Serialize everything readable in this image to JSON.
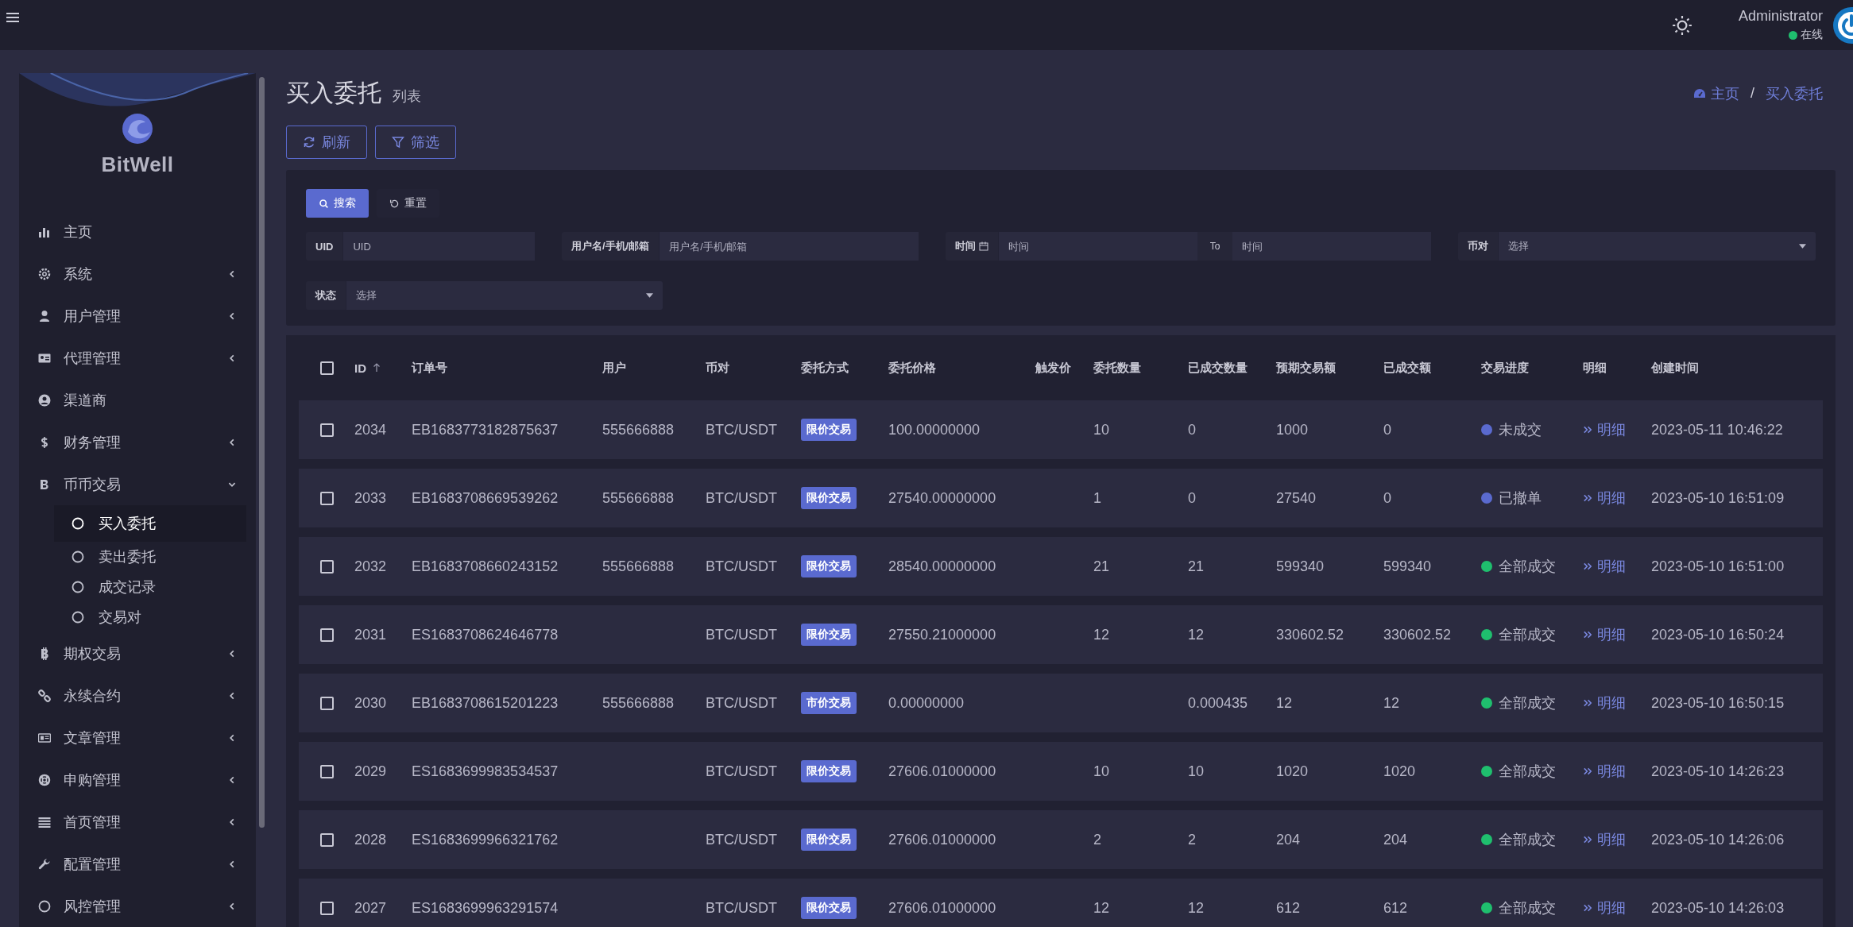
{
  "header": {
    "user_name": "Administrator",
    "status": "在线"
  },
  "sidebar": {
    "brand": "BitWell",
    "items": [
      {
        "label": "主页"
      },
      {
        "label": "系统",
        "expanded": false
      },
      {
        "label": "用户管理",
        "expanded": false
      },
      {
        "label": "代理管理",
        "expanded": false
      },
      {
        "label": "渠道商"
      },
      {
        "label": "财务管理",
        "expanded": false
      },
      {
        "label": "币币交易",
        "expanded": true,
        "children": [
          {
            "label": "买入委托",
            "selected": true
          },
          {
            "label": "卖出委托",
            "selected": false
          },
          {
            "label": "成交记录",
            "selected": false
          },
          {
            "label": "交易对",
            "selected": false
          }
        ]
      },
      {
        "label": "期权交易",
        "expanded": false
      },
      {
        "label": "永续合约",
        "expanded": false
      },
      {
        "label": "文章管理",
        "expanded": false
      },
      {
        "label": "申购管理",
        "expanded": false
      },
      {
        "label": "首页管理",
        "expanded": false
      },
      {
        "label": "配置管理",
        "expanded": false
      },
      {
        "label": "风控管理",
        "expanded": false
      }
    ]
  },
  "page": {
    "title": "买入委托",
    "subtitle": "列表",
    "breadcrumb": [
      "主页",
      "买入委托"
    ],
    "breadcrumb_separator": "/",
    "buttons": [
      "刷新",
      "筛选"
    ]
  },
  "filter": {
    "search_button": "搜索",
    "reset_button": "重置",
    "fields": [
      {
        "kind": "text",
        "label": "UID",
        "placeholder": "UID"
      },
      {
        "kind": "text",
        "label": "用户名/手机/邮箱",
        "placeholder": "用户名/手机/邮箱"
      },
      {
        "kind": "range",
        "label": "时间",
        "placeholder": "时间",
        "separator": "To",
        "placeholder_end": "时间"
      },
      {
        "kind": "select",
        "label": "币对",
        "placeholder": "选择"
      },
      {
        "kind": "select",
        "label": "状态",
        "placeholder": "选择"
      }
    ]
  },
  "table": {
    "select_all_checked": false,
    "columns": [
      "ID",
      "订单号",
      "用户",
      "币对",
      "委托方式",
      "委托价格",
      "触发价",
      "委托数量",
      "已成交数量",
      "预期交易额",
      "已成交额",
      "交易进度",
      "明细",
      "创建时间"
    ],
    "rows": [
      {
        "checked": false,
        "id": "2034",
        "order_no": "EB1683773182875637",
        "user": "555666888",
        "pair": "BTC/USDT",
        "order_type": "限价交易",
        "price": "100.00000000",
        "quantity": "10",
        "filled_quantity": "0",
        "expected_amount": "1000",
        "filled_amount": "0",
        "progress": "未成交",
        "color": "#5a6acf",
        "detail": "明细",
        "created": "2023-05-11 10:46:22"
      },
      {
        "checked": false,
        "id": "2033",
        "order_no": "EB1683708669539262",
        "user": "555666888",
        "pair": "BTC/USDT",
        "order_type": "限价交易",
        "price": "27540.00000000",
        "quantity": "1",
        "filled_quantity": "0",
        "expected_amount": "27540",
        "filled_amount": "0",
        "progress": "已撤单",
        "color": "#5a6acf",
        "detail": "明细",
        "created": "2023-05-10 16:51:09"
      },
      {
        "checked": false,
        "id": "2032",
        "order_no": "EB1683708660243152",
        "user": "555666888",
        "pair": "BTC/USDT",
        "order_type": "限价交易",
        "price": "28540.00000000",
        "quantity": "21",
        "filled_quantity": "21",
        "expected_amount": "599340",
        "filled_amount": "599340",
        "progress": "全部成交",
        "color": "#1fbf6e",
        "detail": "明细",
        "created": "2023-05-10 16:51:00"
      },
      {
        "checked": false,
        "id": "2031",
        "order_no": "ES1683708624646778",
        "pair": "BTC/USDT",
        "order_type": "限价交易",
        "price": "27550.21000000",
        "quantity": "12",
        "filled_quantity": "12",
        "expected_amount": "330602.52",
        "filled_amount": "330602.52",
        "progress": "全部成交",
        "color": "#1fbf6e",
        "detail": "明细",
        "created": "2023-05-10 16:50:24"
      },
      {
        "checked": false,
        "id": "2030",
        "order_no": "EB1683708615201223",
        "user": "555666888",
        "pair": "BTC/USDT",
        "order_type": "市价交易",
        "price": "0.00000000",
        "filled_quantity": "0.000435",
        "expected_amount": "12",
        "filled_amount": "12",
        "progress": "全部成交",
        "color": "#1fbf6e",
        "detail": "明细",
        "created": "2023-05-10 16:50:15"
      },
      {
        "checked": false,
        "id": "2029",
        "order_no": "ES1683699983534537",
        "pair": "BTC/USDT",
        "order_type": "限价交易",
        "price": "27606.01000000",
        "quantity": "10",
        "filled_quantity": "10",
        "expected_amount": "1020",
        "filled_amount": "1020",
        "progress": "全部成交",
        "color": "#1fbf6e",
        "detail": "明细",
        "created": "2023-05-10 14:26:23"
      },
      {
        "checked": false,
        "id": "2028",
        "order_no": "ES1683699966321762",
        "pair": "BTC/USDT",
        "order_type": "限价交易",
        "price": "27606.01000000",
        "quantity": "2",
        "filled_quantity": "2",
        "expected_amount": "204",
        "filled_amount": "204",
        "progress": "全部成交",
        "color": "#1fbf6e",
        "detail": "明细",
        "created": "2023-05-10 14:26:06"
      },
      {
        "checked": false,
        "id": "2027",
        "order_no": "ES1683699963291574",
        "pair": "BTC/USDT",
        "order_type": "限价交易",
        "price": "27606.01000000",
        "quantity": "12",
        "filled_quantity": "12",
        "expected_amount": "612",
        "filled_amount": "612",
        "progress": "全部成交",
        "color": "#1fbf6e",
        "detail": "明细",
        "created": "2023-05-10 14:26:03"
      }
    ]
  }
}
